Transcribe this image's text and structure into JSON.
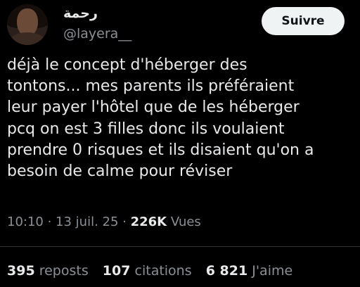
{
  "author": {
    "display_name": "رحمة",
    "handle": "@layera__"
  },
  "follow_label": "Suivre",
  "tweet": {
    "text": "déjà le concept d'héberger des\ntontons... mes parents ils préféraient\nleur payer l'hôtel que de les héberger\npcq on est 3 filles donc ils voulaient\nprendre 0 risques et ils disaient qu'on a\nbesoin de calme pour réviser"
  },
  "meta": {
    "time": "10:10",
    "sep1": " · ",
    "date": "13 juil. 25",
    "sep2": " · ",
    "views_count": "226K",
    "views_label": " Vues"
  },
  "stats": {
    "reposts_count": "395",
    "reposts_label": "reposts",
    "quotes_count": "107",
    "quotes_label": "citations",
    "likes_count": "6 821",
    "likes_label": "J'aime"
  },
  "colors": {
    "background": "#000000",
    "text_primary": "#e7e9ea",
    "text_secondary": "#8b9097",
    "follow_button_bg": "#eff3f4",
    "follow_button_text": "#0f1419"
  }
}
